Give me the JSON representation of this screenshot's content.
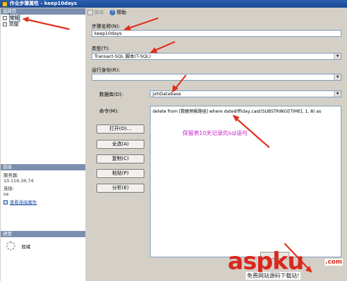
{
  "window": {
    "title": "作业步骤属性 - keep10days"
  },
  "left_pane": {
    "header": "选择页",
    "pages": [
      {
        "label": "常规",
        "selected": true
      },
      {
        "label": "高级",
        "selected": false
      }
    ]
  },
  "connection": {
    "header": "连接",
    "server_label": "服务器:",
    "server_value": "10.116.36.74",
    "conn_label": "连接:",
    "conn_value": "sa",
    "link_label": "查看连接属性"
  },
  "progress": {
    "header": "进度",
    "status": "就绪"
  },
  "toolbar": {
    "script_label": "脚本",
    "help_label": "帮助"
  },
  "form": {
    "step_name_label": "步骤名称(N):",
    "step_name_value": "keep10days",
    "type_label": "类型(T):",
    "type_value": "Transact-SQL 脚本(T-SQL)",
    "run_as_label": "运行身份(R):",
    "run_as_value": "",
    "database_label": "数据库(D):",
    "database_value": "JxhDatabase",
    "command_label": "命令(M):",
    "command_value": "delete from [数据预报路径] where datediff(day,cast(SUBSTRING([TIME], 1, 8) as"
  },
  "buttons": {
    "open": "打开(O)...",
    "select_all": "全选(A)",
    "copy": "复制(C)",
    "paste": "粘贴(P)",
    "parse": "分析(E)"
  },
  "annotation": "保留表10天记录的sql语句",
  "watermark": {
    "brand": "aspku",
    "tld": ".com",
    "sub": "免费网站源码下载站!"
  },
  "colors": {
    "title_bar": "#1b4a96",
    "annotation": "#cc22cc",
    "arrows": "#e0301e",
    "watermark": "#d9281f"
  }
}
